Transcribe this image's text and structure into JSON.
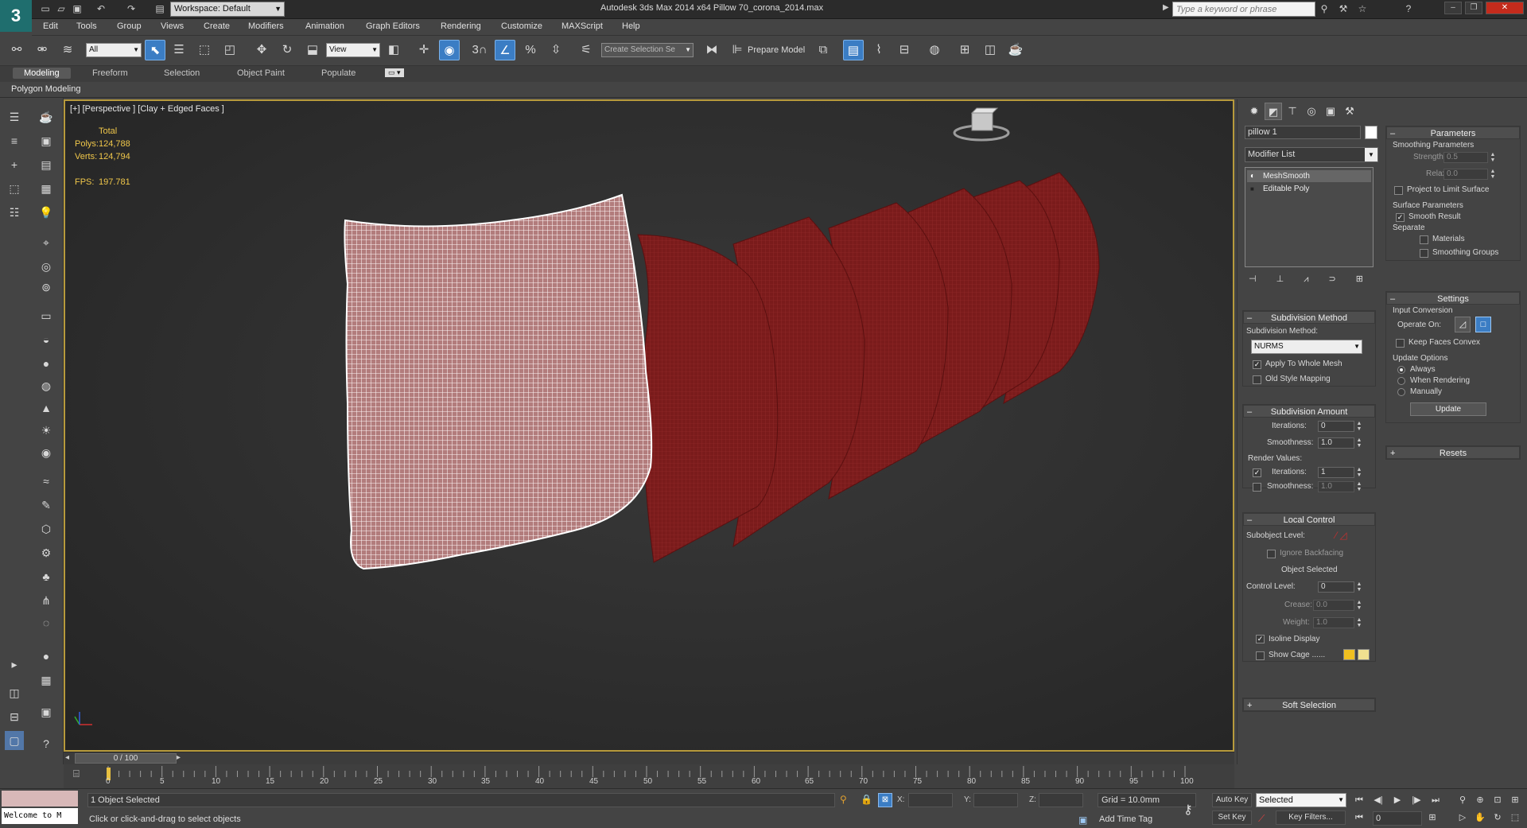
{
  "app": {
    "title": "Autodesk 3ds Max  2014 x64      Pillow 70_corona_2014.max",
    "workspace": "Workspace: Default",
    "search_placeholder": "Type a keyword or phrase",
    "logo": "3"
  },
  "menu": [
    "Edit",
    "Tools",
    "Group",
    "Views",
    "Create",
    "Modifiers",
    "Animation",
    "Graph Editors",
    "Rendering",
    "Customize",
    "MAXScript",
    "Help"
  ],
  "toolbar": {
    "selection_filter": "All",
    "ref_coord": "View",
    "snap_angle": "3",
    "selection_set_placeholder": "Create Selection Se",
    "prepare_model": "Prepare Model"
  },
  "ribbon": {
    "tabs": [
      "Modeling",
      "Freeform",
      "Selection",
      "Object Paint",
      "Populate"
    ],
    "active_tab": "Modeling",
    "panel_label": "Polygon Modeling"
  },
  "viewport": {
    "label": "[+] [Perspective ] [Clay + Edged Faces ]",
    "stats": {
      "header": "Total",
      "polys_label": "Polys:",
      "polys": "124,788",
      "verts_label": "Verts:",
      "verts": "124,794",
      "fps_label": "FPS:",
      "fps": "197.781"
    },
    "colors": {
      "border": "#b79a3c",
      "stats": "#f0c74a",
      "pillow": "#7a1a1a",
      "pillow_wire": "#ffffff"
    }
  },
  "command_panel": {
    "object_name": "pillow 1",
    "modifier_list": "Modifier List",
    "stack": [
      "MeshSmooth",
      "Editable Poly"
    ],
    "subdivision_method": {
      "title": "Subdivision Method",
      "label": "Subdivision Method:",
      "value": "NURMS",
      "apply_whole_mesh": "Apply To Whole Mesh",
      "old_style_mapping": "Old Style Mapping"
    },
    "subdivision_amount": {
      "title": "Subdivision Amount",
      "iterations_label": "Iterations:",
      "iterations": "0",
      "smoothness_label": "Smoothness:",
      "smoothness": "1.0",
      "render_values": "Render Values:",
      "r_iterations_label": "Iterations:",
      "r_iterations": "1",
      "r_smoothness_label": "Smoothness:",
      "r_smoothness": "1.0"
    },
    "local_control": {
      "title": "Local Control",
      "subobject_level": "Subobject Level:",
      "ignore_backfacing": "Ignore Backfacing",
      "object_selected": "Object Selected",
      "control_level_label": "Control Level:",
      "control_level": "0",
      "crease_label": "Crease:",
      "crease": "0.0",
      "weight_label": "Weight:",
      "weight": "1.0",
      "isoline_display": "Isoline Display",
      "show_cage": "Show Cage ......",
      "cage_colors": [
        "#f0c020",
        "#f0e090"
      ]
    },
    "soft_selection": "Soft Selection",
    "parameters": {
      "title": "Parameters",
      "smoothing_parameters": "Smoothing Parameters",
      "strength_label": "Strength:",
      "strength": "0.5",
      "relax_label": "Relax:",
      "relax": "0.0",
      "project_limit": "Project to Limit Surface",
      "surface_parameters": "Surface Parameters",
      "smooth_result": "Smooth Result",
      "separate": "Separate",
      "materials": "Materials",
      "smoothing_groups": "Smoothing Groups"
    },
    "settings": {
      "title": "Settings",
      "input_conversion": "Input Conversion",
      "operate_on": "Operate On:",
      "keep_faces_convex": "Keep Faces Convex",
      "update_options": "Update Options",
      "always": "Always",
      "when_rendering": "When Rendering",
      "manually": "Manually",
      "update_button": "Update"
    },
    "resets": "Resets"
  },
  "timeline": {
    "frame_indicator": "0 / 100",
    "ticks": [
      "0",
      "5",
      "10",
      "15",
      "20",
      "25",
      "30",
      "35",
      "40",
      "45",
      "50",
      "55",
      "60",
      "65",
      "70",
      "75",
      "80",
      "85",
      "90",
      "95",
      "100"
    ]
  },
  "status": {
    "welcome": "Welcome to M",
    "selection": "1 Object Selected",
    "prompt": "Click or click-and-drag to select objects",
    "x_label": "X:",
    "y_label": "Y:",
    "z_label": "Z:",
    "grid": "Grid = 10.0mm",
    "add_time_tag": "Add Time Tag",
    "auto_key": "Auto Key",
    "set_key": "Set Key",
    "key_mode": "Selected",
    "key_filters": "Key Filters...",
    "current_frame": "0"
  }
}
